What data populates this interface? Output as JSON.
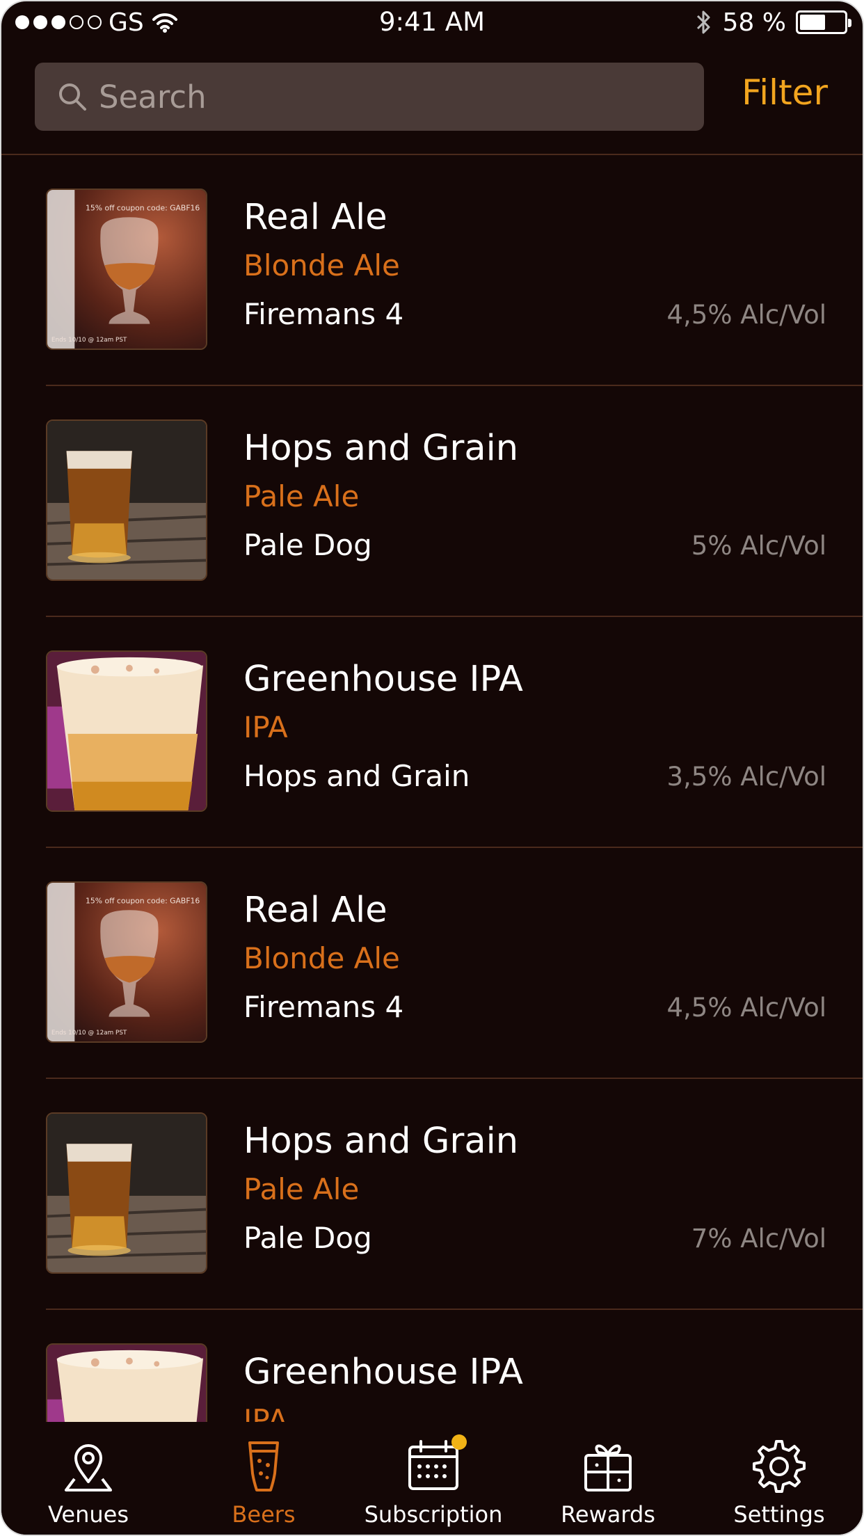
{
  "status_bar": {
    "carrier": "GS",
    "time": "9:41 AM",
    "battery": "58 %",
    "battery_level": 0.58
  },
  "search": {
    "placeholder": "Search",
    "filter_label": "Filter"
  },
  "beers": [
    {
      "name": "Real Ale",
      "style": "Blonde Ale",
      "brewery": "Firemans 4",
      "abv": "4,5% Alc/Vol",
      "image": "tasting-glass"
    },
    {
      "name": "Hops and Grain",
      "style": "Pale Ale",
      "brewery": "Pale Dog",
      "abv": "5% Alc/Vol",
      "image": "pint-glass"
    },
    {
      "name": "Greenhouse IPA",
      "style": "IPA",
      "brewery": "Hops and Grain",
      "abv": "3,5% Alc/Vol",
      "image": "foamy-glass"
    },
    {
      "name": "Real Ale",
      "style": "Blonde Ale",
      "brewery": "Firemans 4",
      "abv": "4,5% Alc/Vol",
      "image": "tasting-glass"
    },
    {
      "name": "Hops and Grain",
      "style": "Pale Ale",
      "brewery": "Pale Dog",
      "abv": "7% Alc/Vol",
      "image": "pint-glass"
    },
    {
      "name": "Greenhouse IPA",
      "style": "IPA",
      "brewery": "",
      "abv": "",
      "image": "foamy-glass"
    }
  ],
  "thumb_text": {
    "coupon": "15% off coupon code: GABF16",
    "ends": "Ends 10/10 @ 12am PST"
  },
  "tabs": [
    {
      "label": "Venues",
      "icon": "map-pin-icon",
      "active": false
    },
    {
      "label": "Beers",
      "icon": "beer-glass-icon",
      "active": true
    },
    {
      "label": "Subscription",
      "icon": "calendar-icon",
      "active": false
    },
    {
      "label": "Rewards",
      "icon": "gift-icon",
      "active": false
    },
    {
      "label": "Settings",
      "icon": "gear-icon",
      "active": false
    }
  ],
  "colors": {
    "background": "#140706",
    "accent_orange": "#d9701b",
    "filter_yellow": "#f2a51f",
    "divider": "#4b2a1c"
  }
}
